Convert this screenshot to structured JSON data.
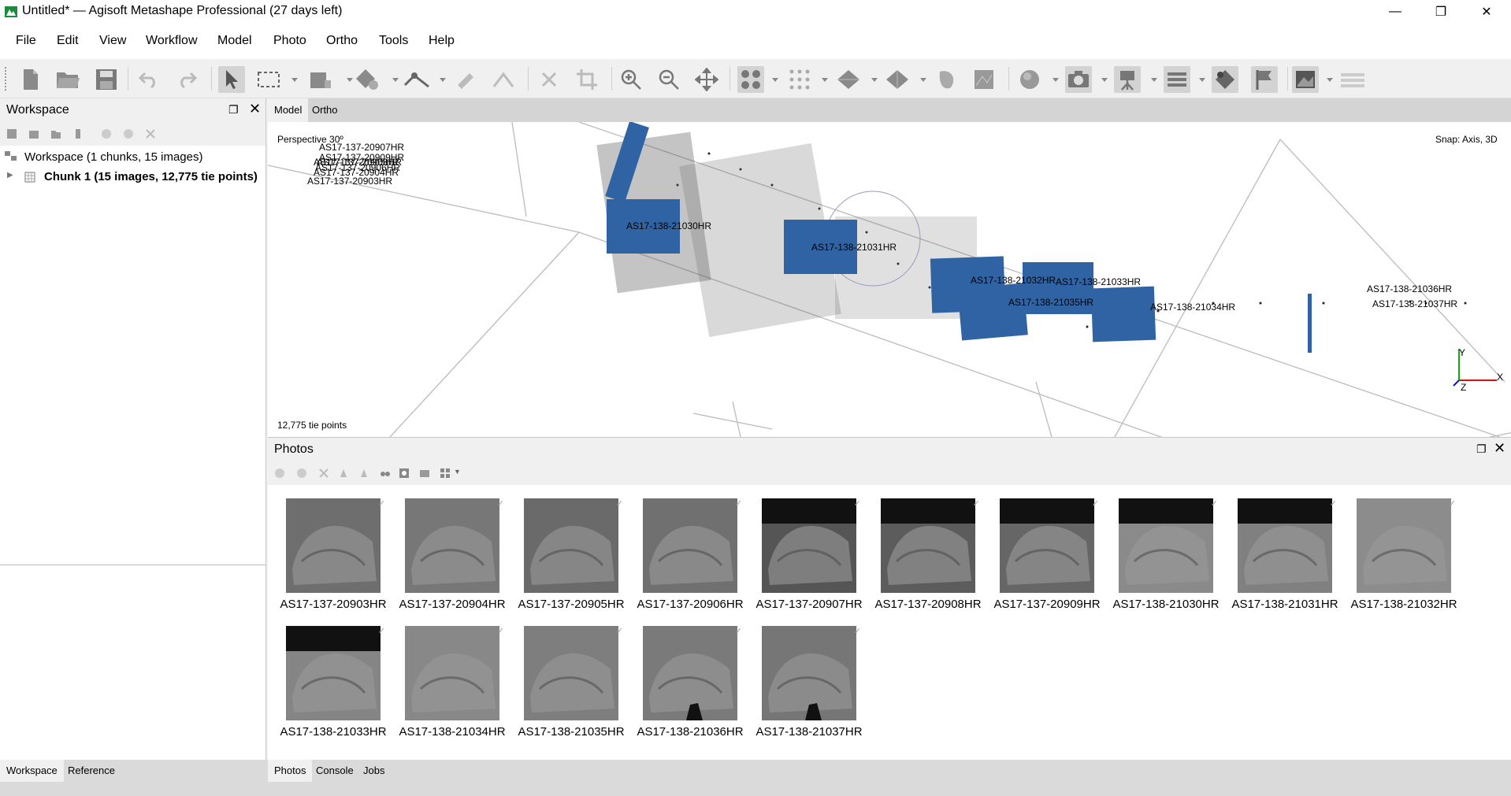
{
  "window": {
    "title": "Untitled* — Agisoft Metashape Professional (27 days left)",
    "minimize": "—",
    "maximize": "❐",
    "close": "✕"
  },
  "menu": [
    "File",
    "Edit",
    "View",
    "Workflow",
    "Model",
    "Photo",
    "Ortho",
    "Tools",
    "Help"
  ],
  "toolbar_icons": [
    "new-icon",
    "open-icon",
    "save-icon",
    "undo-icon",
    "redo-icon",
    "navigation-icon",
    "rectangle-selection-icon",
    "resize-region-icon",
    "rotate-region-icon",
    "ruler-icon",
    "draw-polyline-icon",
    "delete-icon",
    "crop-icon",
    "zoom-in-icon",
    "zoom-out-icon",
    "move-icon",
    "show-points-icon",
    "show-dense-icon",
    "show-model-icon",
    "show-tiled-icon",
    "show-shapes-icon",
    "show-dem-icon",
    "show-ortho-icon",
    "show-cameras-icon",
    "show-markers-icon",
    "show-grid-icon",
    "show-region-icon",
    "show-shapes-flag-icon",
    "show-images-icon",
    "show-layers-icon"
  ],
  "workspace": {
    "title": "Workspace",
    "root_label": "Workspace (1 chunks, 15 images)",
    "chunk_label": "Chunk 1 (15 images, 12,775 tie points)"
  },
  "view_tabs": [
    "Model",
    "Ortho"
  ],
  "viewport": {
    "projection": "Perspective 30º",
    "snap": "Snap: Axis, 3D",
    "tie_points": "12,775 tie points",
    "axis_x": "X",
    "axis_y": "Y",
    "axis_z": "Z",
    "camera_labels": [
      "AS17-137-20907HR",
      "AS17-137-20909HR",
      "AS17-137-20908HR",
      "AS17-137-20906HR",
      "AS17-137-20905HR",
      "AS17-137-20904HR",
      "AS17-137-20903HR",
      "AS17-138-21030HR",
      "AS17-138-21031HR",
      "AS17-138-21032HR",
      "AS17-138-21033HR",
      "AS17-138-21035HR",
      "AS17-138-21034HR",
      "AS17-138-21036HR",
      "AS17-138-21037HR"
    ]
  },
  "photos": {
    "title": "Photos",
    "items": [
      "AS17-137-20903HR",
      "AS17-137-20904HR",
      "AS17-137-20905HR",
      "AS17-137-20906HR",
      "AS17-137-20907HR",
      "AS17-137-20908HR",
      "AS17-137-20909HR",
      "AS17-138-21030HR",
      "AS17-138-21031HR",
      "AS17-138-21032HR",
      "AS17-138-21033HR",
      "AS17-138-21034HR",
      "AS17-138-21035HR",
      "AS17-138-21036HR",
      "AS17-138-21037HR"
    ]
  },
  "bottom_tabs_left": [
    "Workspace",
    "Reference"
  ],
  "bottom_tabs_right": [
    "Photos",
    "Console",
    "Jobs"
  ],
  "colors": {
    "camera_blue": "#2f63a3",
    "axis_x": "#d11",
    "axis_y": "#1a1",
    "axis_z": "#11c"
  }
}
